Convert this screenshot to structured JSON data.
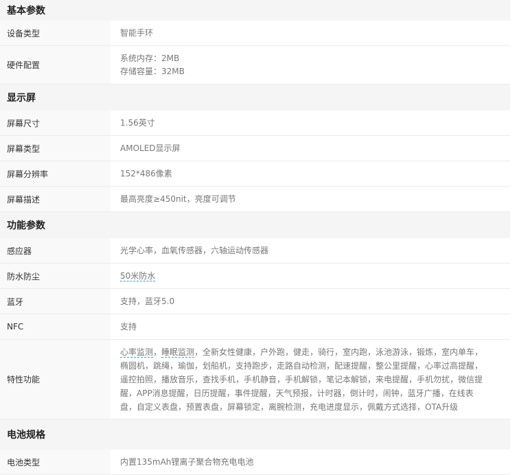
{
  "sections": {
    "basic": "基本参数",
    "display": "显示屏",
    "function": "功能参数",
    "battery": "电池规格"
  },
  "basic": {
    "device_type_label": "设备类型",
    "device_type_value": "智能手环",
    "hardware_label": "硬件配置",
    "hardware_ram": "系统内存：2MB",
    "hardware_storage": "存储容量：32MB"
  },
  "display": {
    "size_label": "屏幕尺寸",
    "size_value": "1.56英寸",
    "type_label": "屏幕类型",
    "type_value": "AMOLED显示屏",
    "resolution_label": "屏幕分辨率",
    "resolution_value": "152*486像素",
    "desc_label": "屏幕描述",
    "desc_value": "最高亮度≥450nit，亮度可调节"
  },
  "function": {
    "sensor_label": "感应器",
    "sensor_value": "光学心率，血氧传感器，六轴运动传感器",
    "waterproof_label": "防水防尘",
    "waterproof_value": "50米防水",
    "bluetooth_label": "蓝牙",
    "bluetooth_value": "支持，蓝牙5.0",
    "nfc_label": "NFC",
    "nfc_value": "支持",
    "features_label": "特性功能",
    "features_link1": "心率监测",
    "features_sep": "，",
    "features_link2": "睡眠监测",
    "features_line1_rest": "，全新女性健康，户外跑，健走，骑行，室内跑，泳池游泳，锻炼，室内单车，",
    "features_line2": "椭圆机，跳绳，瑜伽，划船机，支持跑步，走路自动检测，配速提醒，整公里提醒，心率过高提醒，",
    "features_line3": "遥控拍照，播放音乐，查找手机，手机静音，手机解锁，笔记本解锁，来电提醒，手机勿扰，微信提",
    "features_line4": "醒，APP消息提醒，日历提醒，事件提醒，天气预报，计时器，倒计时，闹钟，蓝牙广播，在线表",
    "features_line5": "盘，自定义表盘，预置表盘，屏幕锁定，离腕检测，充电进度显示，佩戴方式选择，OTA升级"
  },
  "battery": {
    "type_label": "电池类型",
    "type_value": "内置135mAh锂离子聚合物充电电池"
  }
}
